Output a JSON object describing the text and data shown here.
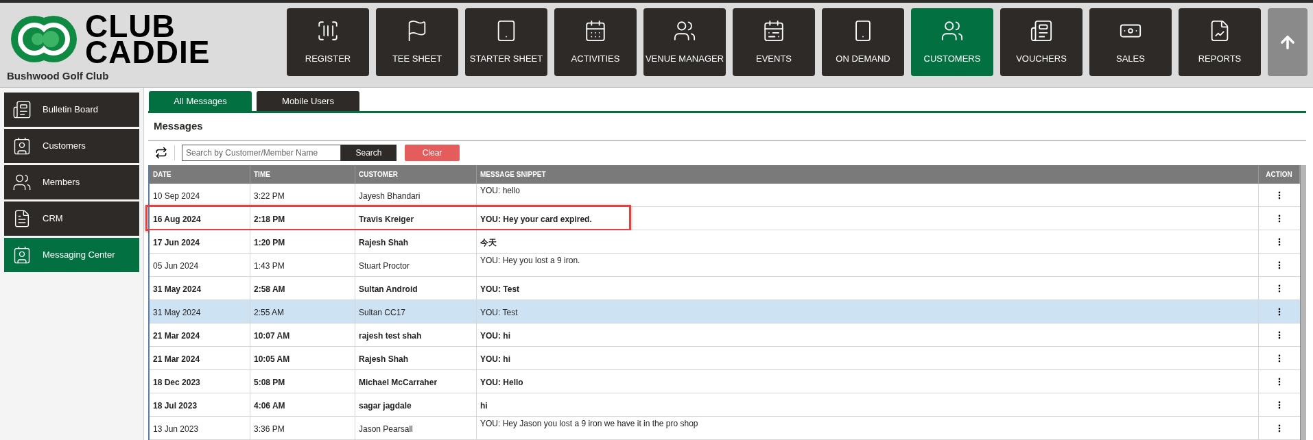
{
  "logo": {
    "line_1": "CLUB",
    "line_2": "CADDIE"
  },
  "club_name": "Bushwood Golf Club",
  "nav": [
    {
      "label": "REGISTER",
      "selected": false
    },
    {
      "label": "TEE SHEET",
      "selected": false
    },
    {
      "label": "STARTER SHEET",
      "selected": false
    },
    {
      "label": "ACTIVITIES",
      "selected": false
    },
    {
      "label": "VENUE MANAGER",
      "selected": false
    },
    {
      "label": "EVENTS",
      "selected": false
    },
    {
      "label": "ON DEMAND",
      "selected": false
    },
    {
      "label": "CUSTOMERS",
      "selected": true
    },
    {
      "label": "VOUCHERS",
      "selected": false
    },
    {
      "label": "SALES",
      "selected": false
    },
    {
      "label": "REPORTS",
      "selected": false
    }
  ],
  "sidebar": {
    "items": [
      {
        "label": "Bulletin Board",
        "selected": false
      },
      {
        "label": "Customers",
        "selected": false
      },
      {
        "label": "Members",
        "selected": false
      },
      {
        "label": "CRM",
        "selected": false
      },
      {
        "label": "Messaging Center",
        "selected": true
      }
    ]
  },
  "tabs": [
    {
      "label": "All Messages",
      "selected": true
    },
    {
      "label": "Mobile Users",
      "selected": false
    }
  ],
  "panel_title": "Messages",
  "search": {
    "placeholder": "Search by Customer/Member Name",
    "button": "Search",
    "clear": "Clear"
  },
  "table": {
    "columns": [
      "DATE",
      "TIME",
      "CUSTOMER",
      "MESSAGE SNIPPET",
      "ACTION"
    ],
    "rows": [
      {
        "date": "10 Sep 2024",
        "time": "3:22 PM",
        "customer": "Jayesh Bhandari",
        "snippet": "YOU: hello",
        "unread": false,
        "selected": false,
        "highlighted": false
      },
      {
        "date": "16 Aug 2024",
        "time": "2:18 PM",
        "customer": "Travis Kreiger",
        "snippet": "YOU: Hey your card expired.",
        "unread": true,
        "selected": false,
        "highlighted": true
      },
      {
        "date": "17 Jun 2024",
        "time": "1:20 PM",
        "customer": "Rajesh Shah",
        "snippet": "今天",
        "unread": true,
        "selected": false,
        "highlighted": false
      },
      {
        "date": "05 Jun 2024",
        "time": "1:43 PM",
        "customer": "Stuart Proctor",
        "snippet": "YOU: Hey you lost a 9 iron.",
        "unread": false,
        "selected": false,
        "highlighted": false
      },
      {
        "date": "31 May 2024",
        "time": "2:58 AM",
        "customer": "Sultan Android",
        "snippet": "YOU: Test",
        "unread": true,
        "selected": false,
        "highlighted": false
      },
      {
        "date": "31 May 2024",
        "time": "2:55 AM",
        "customer": "Sultan CC17",
        "snippet": "YOU: Test",
        "unread": false,
        "selected": true,
        "highlighted": false
      },
      {
        "date": "21 Mar 2024",
        "time": "10:07 AM",
        "customer": "rajesh test shah",
        "snippet": "YOU: hi",
        "unread": true,
        "selected": false,
        "highlighted": false
      },
      {
        "date": "21 Mar 2024",
        "time": "10:05 AM",
        "customer": "Rajesh Shah",
        "snippet": "YOU: hi",
        "unread": true,
        "selected": false,
        "highlighted": false
      },
      {
        "date": "18 Dec 2023",
        "time": "5:08 PM",
        "customer": "Michael McCarraher",
        "snippet": "YOU: Hello",
        "unread": true,
        "selected": false,
        "highlighted": false
      },
      {
        "date": "18 Jul 2023",
        "time": "4:06 AM",
        "customer": "sagar jagdale",
        "snippet": "hi",
        "unread": true,
        "selected": false,
        "highlighted": false
      },
      {
        "date": "13 Jun 2023",
        "time": "3:36 PM",
        "customer": "Jason Pearsall",
        "snippet": "YOU: Hey Jason you lost a 9 iron we have it in the pro shop",
        "unread": false,
        "selected": false,
        "highlighted": false
      }
    ]
  }
}
